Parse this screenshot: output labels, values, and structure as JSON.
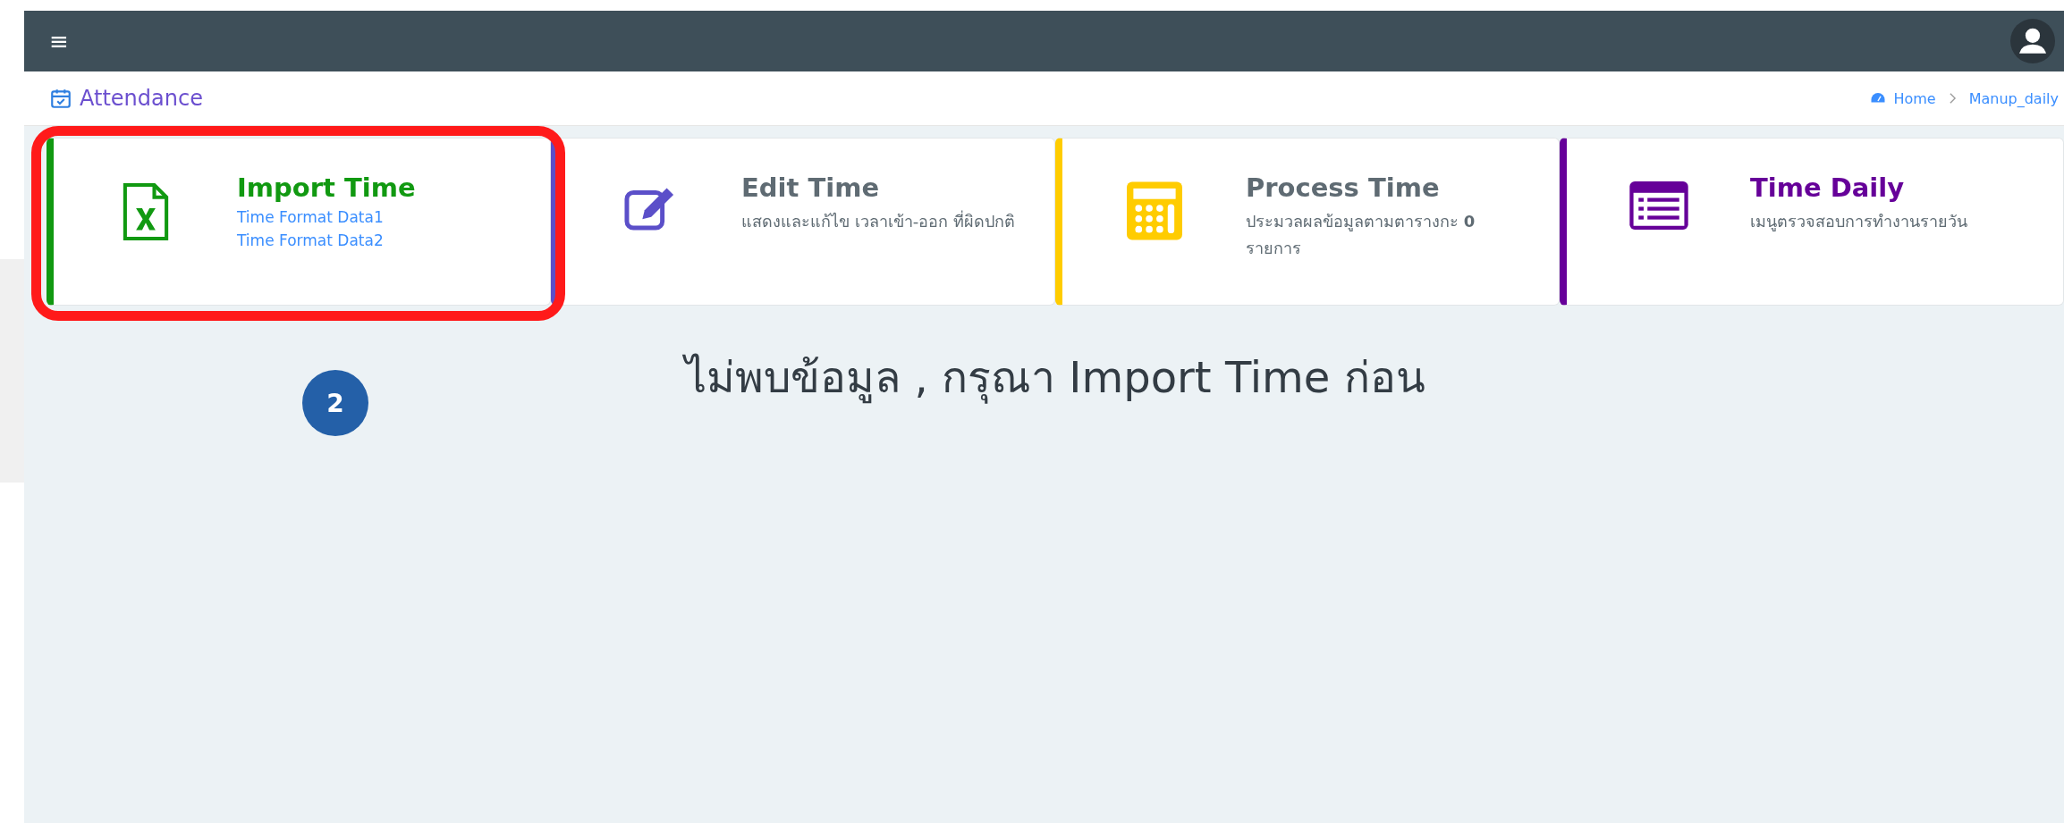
{
  "topbar": {
    "menu_icon": "≡"
  },
  "header": {
    "title": "Attendance",
    "breadcrumb": [
      "Home",
      "Manup_daily"
    ]
  },
  "cards": [
    {
      "kind": "import",
      "title": "Import Time",
      "color": "#119911",
      "links": [
        "Time Format Data1",
        "Time Format Data2"
      ],
      "highlighted": true
    },
    {
      "kind": "edit",
      "title": "Edit Time",
      "color": "#5b4fc9",
      "text": "แสดงและแก้ไข เวลาเข้า-ออก ที่ผิดปกติ"
    },
    {
      "kind": "process",
      "title": "Process Time",
      "color": "#ffcc00",
      "text": "ประมวลผลข้อมูลตามตารางกะ **0** รายการ"
    },
    {
      "kind": "daily",
      "title": "Time Daily",
      "color": "#660099",
      "text": "เมนูตรวจสอบการทำงานรายวัน"
    }
  ],
  "message": "ไม่พบข้อมูล , กรุณา Import Time ก่อน",
  "callout": "2"
}
